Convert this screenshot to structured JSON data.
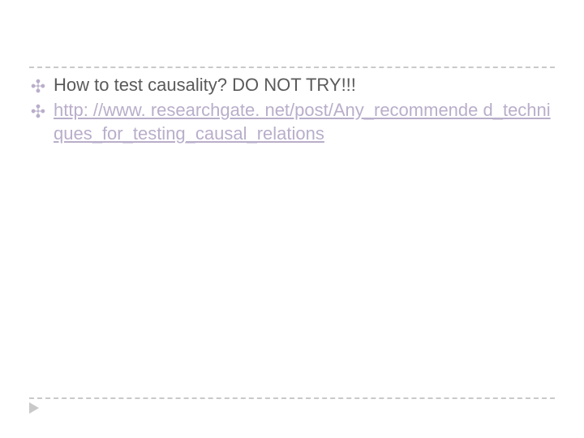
{
  "bullets": [
    {
      "glyph": "✣",
      "text": "How to test causality? DO NOT TRY!!!",
      "is_link": false
    },
    {
      "glyph": "✣",
      "text": "http: //www. researchgate. net/post/Any_recommende d_techniques_for_testing_causal_relations",
      "is_link": true
    }
  ]
}
